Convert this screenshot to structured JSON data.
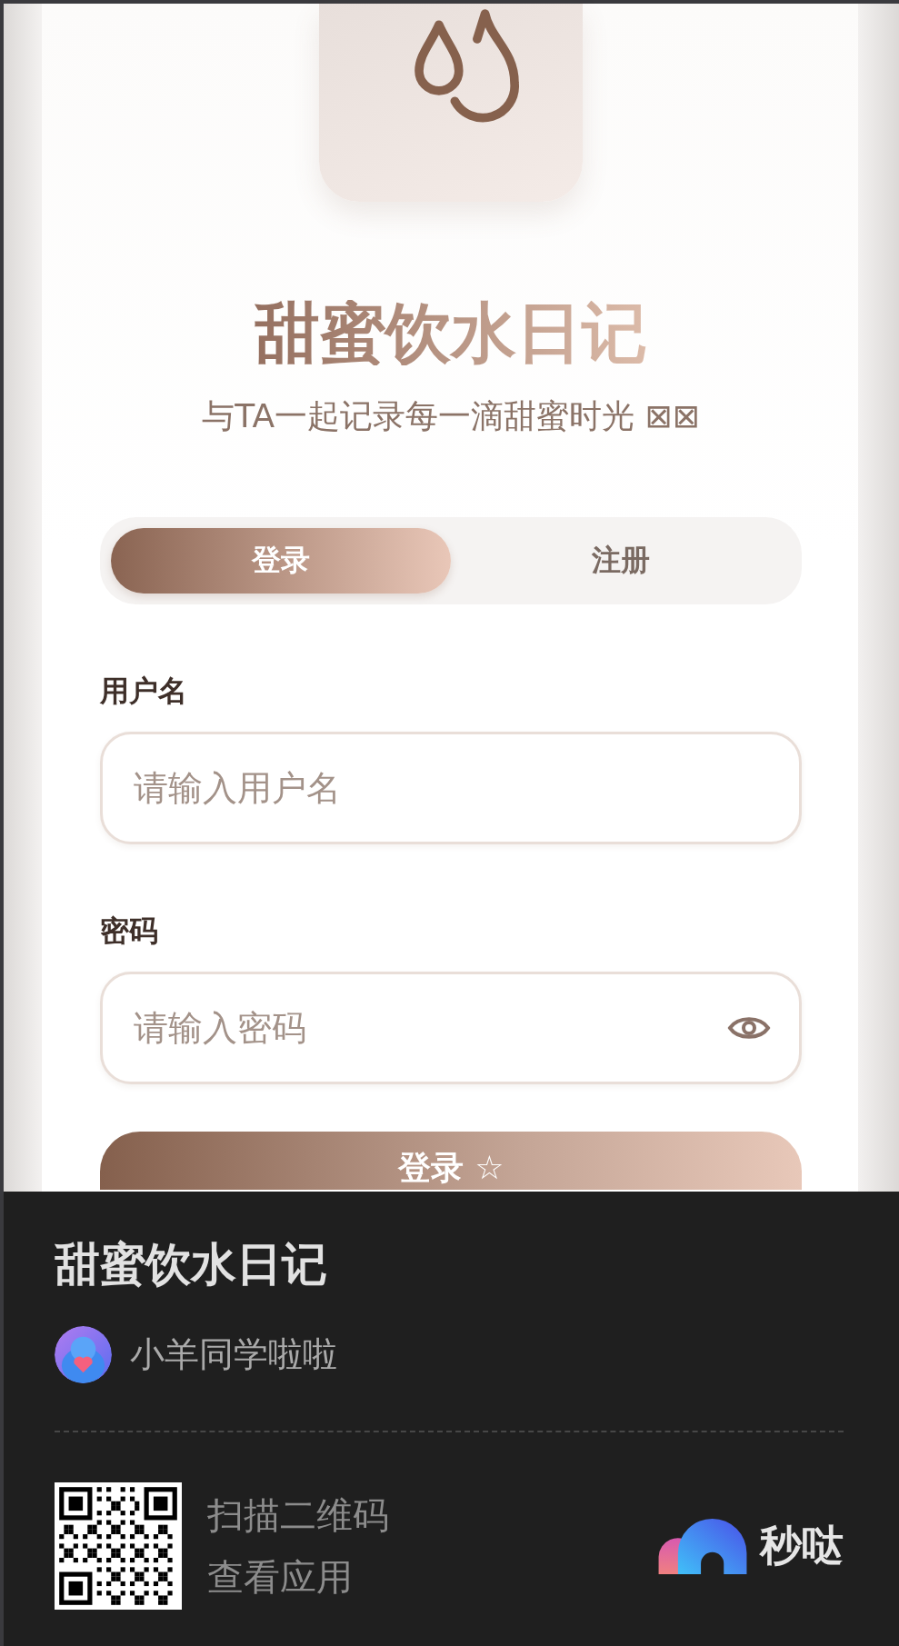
{
  "app": {
    "title": "甜蜜饮水日记",
    "subtitle": "与TA一起记录每一滴甜蜜时光 ⊠⊠"
  },
  "tabs": [
    {
      "label": "登录",
      "selected": true
    },
    {
      "label": "注册",
      "selected": false
    }
  ],
  "fields": [
    {
      "label": "用户名",
      "placeholder": "请输入用户名",
      "kind": "text"
    },
    {
      "label": "密码",
      "placeholder": "请输入密码",
      "kind": "password"
    }
  ],
  "submit": {
    "label": "登录 ☆"
  },
  "footer": {
    "title": "甜蜜饮水日记",
    "author": "小羊同学啦啦",
    "scan_lines": [
      "扫描二维码",
      "查看应用"
    ],
    "brand": "秒哒"
  }
}
